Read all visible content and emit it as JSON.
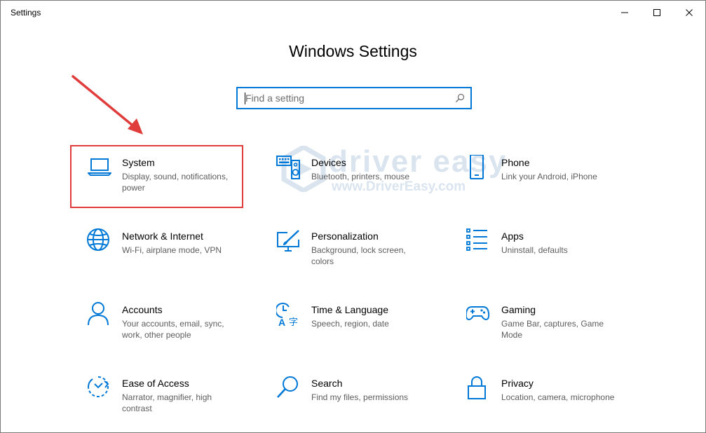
{
  "window": {
    "title": "Settings"
  },
  "header": {
    "title": "Windows Settings"
  },
  "search": {
    "placeholder": "Find a setting"
  },
  "colors": {
    "accent": "#0078d7",
    "highlight": "#e03c3c",
    "description": "#5d5d5d"
  },
  "tiles": [
    {
      "name": "System",
      "description": "Display, sound, notifications, power",
      "icon": "laptop-icon"
    },
    {
      "name": "Devices",
      "description": "Bluetooth, printers, mouse",
      "icon": "keyboard-speaker-icon"
    },
    {
      "name": "Phone",
      "description": "Link your Android, iPhone",
      "icon": "phone-icon"
    },
    {
      "name": "Network & Internet",
      "description": "Wi-Fi, airplane mode, VPN",
      "icon": "globe-icon"
    },
    {
      "name": "Personalization",
      "description": "Background, lock screen, colors",
      "icon": "paint-monitor-icon"
    },
    {
      "name": "Apps",
      "description": "Uninstall, defaults",
      "icon": "app-list-icon"
    },
    {
      "name": "Accounts",
      "description": "Your accounts, email, sync, work, other people",
      "icon": "person-icon"
    },
    {
      "name": "Time & Language",
      "description": "Speech, region, date",
      "icon": "clock-language-icon"
    },
    {
      "name": "Gaming",
      "description": "Game Bar, captures, Game Mode",
      "icon": "gamepad-icon"
    },
    {
      "name": "Ease of Access",
      "description": "Narrator, magnifier, high contrast",
      "icon": "ease-of-access-icon"
    },
    {
      "name": "Search",
      "description": "Find my files, permissions",
      "icon": "magnifier-icon"
    },
    {
      "name": "Privacy",
      "description": "Location, camera, microphone",
      "icon": "lock-icon"
    }
  ],
  "watermark": {
    "brand": "driver easy",
    "url": "www.DriverEasy.com"
  }
}
